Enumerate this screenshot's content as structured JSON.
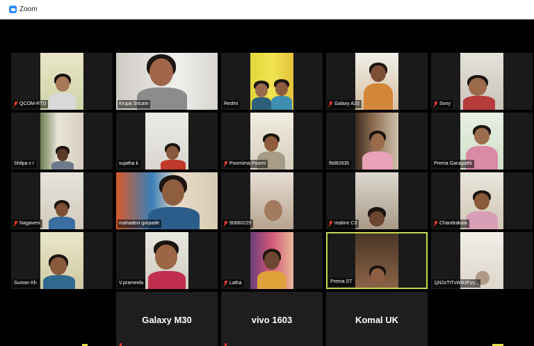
{
  "window": {
    "title": "Zoom"
  },
  "participants": [
    {
      "name": "QCOM-RTD",
      "muted": true
    },
    {
      "name": "Krupa Sricam",
      "muted": false
    },
    {
      "name": "Redmi",
      "muted": false
    },
    {
      "name": "Galaxy A20",
      "muted": true
    },
    {
      "name": "Sony",
      "muted": true
    },
    {
      "name": "Shilpa v r",
      "muted": false
    },
    {
      "name": "sujatha k",
      "muted": false
    },
    {
      "name": "Poornima Poorni",
      "muted": true
    },
    {
      "name": "f8d82835",
      "muted": false
    },
    {
      "name": "Prema Ganapathi",
      "muted": false
    },
    {
      "name": "Nagaveni",
      "muted": true
    },
    {
      "name": "mahadevi gorpade",
      "muted": false
    },
    {
      "name": "90860229",
      "muted": true
    },
    {
      "name": "realme C3",
      "muted": true
    },
    {
      "name": "Chandrakala",
      "muted": true
    },
    {
      "name": "Suman Kh",
      "muted": false
    },
    {
      "name": "V.prameela",
      "muted": false
    },
    {
      "name": "Latha",
      "muted": true
    },
    {
      "name": "Prema ST",
      "muted": false
    },
    {
      "name": "1jN2oTtTvWB3Fyy...",
      "muted": false
    }
  ],
  "audio_only": [
    {
      "name": "Galaxy M30"
    },
    {
      "name": "vivo 1603"
    },
    {
      "name": "Komal UK"
    }
  ],
  "active_speaker": "Prema ST",
  "colors": {
    "active_border": "#c8d94e",
    "muted_icon": "#ff3b30",
    "tile_bg": "#1a1a1a"
  }
}
